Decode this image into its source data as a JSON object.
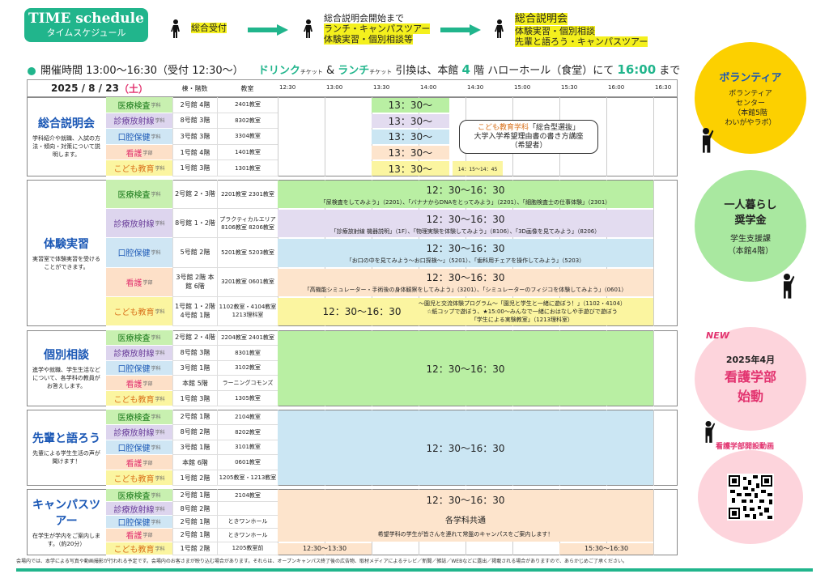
{
  "badge": {
    "title": "TIME schedule",
    "subtitle": "タイムスケジュール"
  },
  "flow": {
    "step1": "総合受付",
    "step2_head": "総合説明会開始まで",
    "step2_items": [
      "ランチ・キャンパスツアー",
      "体験実習・個別相談等"
    ],
    "step3_head": "総合説明会",
    "step3_items": [
      "体験実習・個別相談",
      "先輩と語ろう・キャンパスツアー"
    ]
  },
  "info": {
    "hours": "開催時間 13:00～16:30（受付 12:30～）",
    "drink": "ドリンク",
    "ticket": "チケット",
    "amp": " & ",
    "lunch": "ランチ",
    "exchange": "引換は、本館",
    "floor": "4",
    "exchange2": "階 ハローホール（食堂）にて",
    "until_time": "16:00",
    "until": "まで"
  },
  "table": {
    "date_prefix": "2025 / 8 / 23",
    "dow": "（土）",
    "col_floor": "棟・階数",
    "col_room": "教室",
    "times": [
      "12:30",
      "13:00",
      "13:30",
      "14:00",
      "14:30",
      "15:00",
      "15:30",
      "16:00",
      "16:30"
    ]
  },
  "sections": [
    {
      "title": "総合説明会",
      "desc": "学科紹介や就職、入試の方法・傾向・対策について説明します。",
      "rows": [
        {
          "dept": "医療検査",
          "sub": "学科",
          "floor": "2号館 4階",
          "room": "2401教室",
          "time": "13：30～"
        },
        {
          "dept": "診療放射線",
          "sub": "学科",
          "floor": "8号館 3階",
          "room": "8302教室",
          "time": "13：30～"
        },
        {
          "dept": "口腔保健",
          "sub": "学科",
          "floor": "3号館 3階",
          "room": "3304教室",
          "time": "13：30～"
        },
        {
          "dept": "看護",
          "sub": "学部",
          "floor": "1号館 4階",
          "room": "1401教室",
          "time": "13：30～"
        },
        {
          "dept": "こども教育",
          "sub": "学科",
          "floor": "1号館 3階",
          "room": "1301教室",
          "time": "13：30～"
        }
      ],
      "callout": {
        "dept": "こども教育学科",
        "line1": "「総合型選抜」",
        "line2": "大学入学希望理由書の書き方講座",
        "line3": "（希望者）"
      },
      "extra_time": "14：15～14：45"
    },
    {
      "title": "体験実習",
      "desc": "実習室で体験実習を受けることができます。",
      "rows": [
        {
          "dept": "医療検査",
          "sub": "学科",
          "floor": "2号館 2・3階",
          "room": "2201教室 2301教室",
          "time": "12：30～16：30",
          "desc": "「尿検査をしてみよう」（2201）、「バナナからDNAをとってみよう」（2201）、「細胞検査士の仕事体験」（2301）"
        },
        {
          "dept": "診療放射線",
          "sub": "学科",
          "floor": "8号館 1・2階",
          "room": "プラクティカルエリア 8106教室 8206教室",
          "time": "12：30～16：30",
          "desc": "「診療放射線 機器説明」（1F）、「物理実験を体験してみよう」（8106）、「3D画像を見てみよう」（8206）"
        },
        {
          "dept": "口腔保健",
          "sub": "学科",
          "floor": "5号館 2階",
          "room": "5201教室 5203教室",
          "time": "12：30～16：30",
          "desc": "「お口の中を見てみよう～お口探検～」（5201）、「歯科用チェアを操作してみよう」（5203）"
        },
        {
          "dept": "看護",
          "sub": "学部",
          "floor": "3号館 2階 本館 6階",
          "room": "3201教室 0601教室",
          "time": "12：30～16：30",
          "desc": "「高機能シミュレーター・手術後の身体観察をしてみよう」（3201）、「シミュレーターのフィジコを体験してみよう」（0601）"
        },
        {
          "dept": "こども教育",
          "sub": "学科",
          "floor": "1号館 1・2階 4号館 1階",
          "room": "1102教室・4104教室 1213理科室",
          "time": "12：30～16：30",
          "desc1": "～園児と交流体験プログラム～「園児と学生と一緒に遊ぼう！」（1102・4104）",
          "desc2": "☆紙コップで遊ぼう、★15:00～みんなで一緒におはなしや手遊びで遊ぼう",
          "desc3": "「学生による実験教室」（1213理科室）"
        }
      ]
    },
    {
      "title": "個別相談",
      "desc": "進学や就職、学生生活などについて、各学科の教員がお答えします。",
      "time": "12：30～16：30",
      "rows": [
        {
          "dept": "医療検査",
          "sub": "学科",
          "floor": "2号館 2・4階",
          "room": "2204教室 2401教室"
        },
        {
          "dept": "診療放射線",
          "sub": "学科",
          "floor": "8号館 3階",
          "room": "8301教室"
        },
        {
          "dept": "口腔保健",
          "sub": "学科",
          "floor": "3号館 1階",
          "room": "3102教室"
        },
        {
          "dept": "看護",
          "sub": "学部",
          "floor": "本館 5階",
          "room": "ラーニングコモンズ"
        },
        {
          "dept": "こども教育",
          "sub": "学科",
          "floor": "1号館 3階",
          "room": "1305教室"
        }
      ]
    },
    {
      "title": "先輩と語ろう",
      "desc": "先輩による学生生活の声が聞けます！",
      "time": "12：30～16：30",
      "rows": [
        {
          "dept": "医療検査",
          "sub": "学科",
          "floor": "2号館 1階",
          "room": "2104教室"
        },
        {
          "dept": "診療放射線",
          "sub": "学科",
          "floor": "8号館 2階",
          "room": "8202教室"
        },
        {
          "dept": "口腔保健",
          "sub": "学科",
          "floor": "3号館 1階",
          "room": "3101教室"
        },
        {
          "dept": "看護",
          "sub": "学部",
          "floor": "本館 6階",
          "room": "0601教室"
        },
        {
          "dept": "こども教育",
          "sub": "学科",
          "floor": "1号館 2階",
          "room": "1205教室・1213教室"
        }
      ]
    },
    {
      "title": "キャンパスツアー",
      "desc": "在学生が学内をご案内します。（約20分）",
      "time": "12：30～16：30",
      "common": "各学科共通",
      "common_desc": "希望学科の学生が皆さんを連れて常盤のキャンパスをご案内します！",
      "time_a": "12:30～13:30",
      "time_b": "15:30～16:30",
      "rows": [
        {
          "dept": "医療検査",
          "sub": "学科",
          "floor": "2号館 1階",
          "room": "2104教室"
        },
        {
          "dept": "診療放射線",
          "sub": "学科",
          "floor": "8号館 2階",
          "room": ""
        },
        {
          "dept": "口腔保健",
          "sub": "学科",
          "floor": "2号館 1階",
          "room": "ときワンホール"
        },
        {
          "dept": "看護",
          "sub": "学部",
          "floor": "2号館 1階",
          "room": "ときワンホール"
        },
        {
          "dept": "こども教育",
          "sub": "学科",
          "floor": "1号館 2階",
          "room": "1205教室前"
        }
      ]
    }
  ],
  "side": {
    "volunteer": {
      "title": "ボランティア",
      "line1": "ボランティア",
      "line2": "センター",
      "line3": "（本館5階",
      "line4": "わいがやラボ）"
    },
    "living": {
      "title1": "一人暮らし",
      "title2": "奨学金",
      "line1": "学生支援課",
      "line2": "（本館4階）"
    },
    "nursing": {
      "new": "NEW",
      "date": "2025年4月",
      "title": "看護学部",
      "sub": "始動"
    },
    "video_label": "看護学部開設動画"
  },
  "footer": "会場内では、本学による写真や動画撮影が行われる予定です。会場内のお客さまが映り込む場合があります。それらは、オープンキャンパス終了後の広告物、取材メディアによるテレビ／新聞／雑誌／WEBなどに露出／掲載される場合がありますので、あらかじめご了承ください。",
  "colors": {
    "accent": "#21b58c",
    "title_blue": "#1a57b5",
    "dept_green": "#c8f0b0",
    "dept_lav": "#ddd5ee",
    "dept_blue": "#cfe6f4",
    "dept_peach": "#fde0c8",
    "dept_yellow": "#fbf5a0",
    "bar_green": "#b9efa3",
    "bar_blue": "#cbe6f3",
    "bar_peach": "#fde4cc"
  }
}
